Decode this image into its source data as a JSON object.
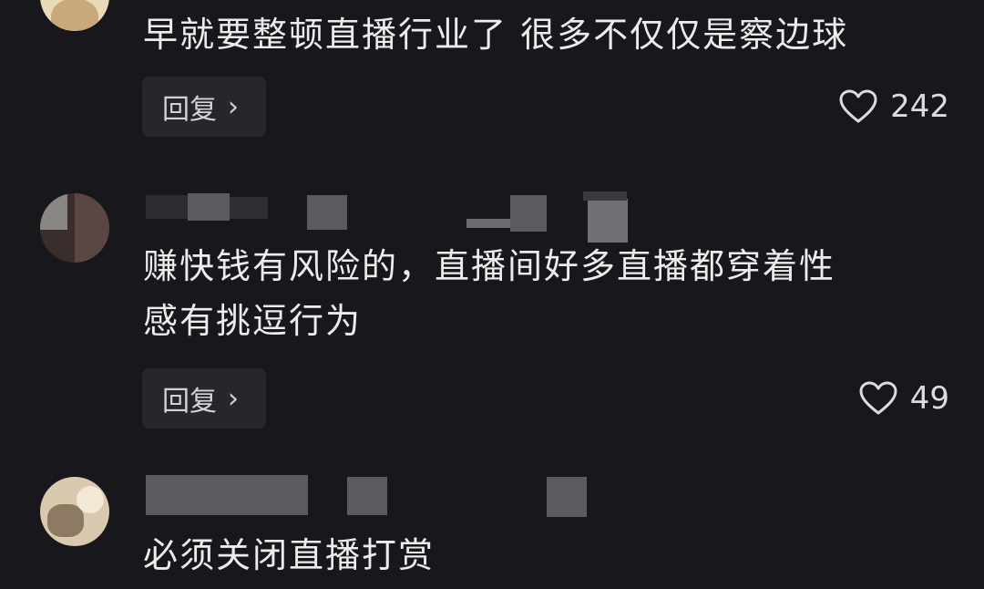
{
  "comments": [
    {
      "text": "早就要整顿直播行业了 很多不仅仅是察边球",
      "reply_label": "回复",
      "reply_chevron": "›",
      "like_icon": "heart-outline-icon",
      "likes": "242"
    },
    {
      "text": "赚快钱有风险的，直播间好多直播都穿着性\n感有挑逗行为",
      "reply_label": "回复",
      "reply_chevron": "›",
      "like_icon": "heart-outline-icon",
      "likes": "49"
    },
    {
      "text": "必须关闭直播打赏"
    }
  ],
  "colors": {
    "background": "#17171c",
    "text": "#ececed",
    "reply_bg": "#26262c"
  }
}
